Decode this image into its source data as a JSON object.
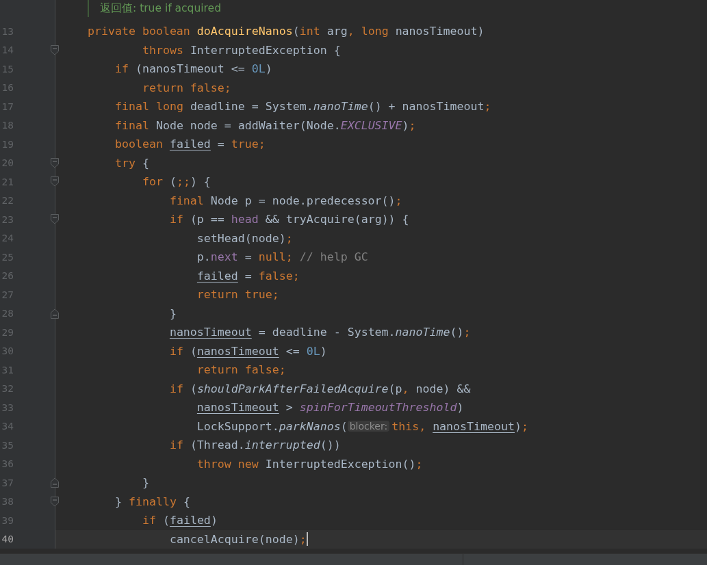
{
  "editor": {
    "doc_comment": "返回值: true if acquired",
    "lines": [
      {
        "number": "13",
        "fold_start": false,
        "fold_end": false,
        "current": false,
        "tokens": [
          {
            "kind": "keyword",
            "text": "private boolean "
          },
          {
            "kind": "method",
            "text": "doAcquireNanos"
          },
          {
            "kind": "plain",
            "text": "("
          },
          {
            "kind": "keyword",
            "text": "int "
          },
          {
            "kind": "plain",
            "text": "arg"
          },
          {
            "kind": "keyword",
            "text": ", long "
          },
          {
            "kind": "plain",
            "text": "nanosTimeout)"
          }
        ]
      },
      {
        "number": "14",
        "fold_start": true,
        "fold_end": false,
        "current": false,
        "tokens": [
          {
            "kind": "keyword",
            "text": "        throws "
          },
          {
            "kind": "plain",
            "text": "InterruptedException {"
          }
        ]
      },
      {
        "number": "15",
        "fold_start": false,
        "fold_end": false,
        "current": false,
        "tokens": [
          {
            "kind": "keyword",
            "text": "    if "
          },
          {
            "kind": "plain",
            "text": "(nanosTimeout <= "
          },
          {
            "kind": "number",
            "text": "0L"
          },
          {
            "kind": "plain",
            "text": ")"
          }
        ]
      },
      {
        "number": "16",
        "fold_start": false,
        "fold_end": false,
        "current": false,
        "tokens": [
          {
            "kind": "keyword",
            "text": "        return false;"
          }
        ]
      },
      {
        "number": "17",
        "fold_start": false,
        "fold_end": false,
        "current": false,
        "tokens": [
          {
            "kind": "keyword",
            "text": "    final long "
          },
          {
            "kind": "plain",
            "text": "deadline = System."
          },
          {
            "kind": "static",
            "text": "nanoTime"
          },
          {
            "kind": "plain",
            "text": "() + nanosTimeout"
          },
          {
            "kind": "keyword",
            "text": ";"
          }
        ]
      },
      {
        "number": "18",
        "fold_start": false,
        "fold_end": false,
        "current": false,
        "tokens": [
          {
            "kind": "keyword",
            "text": "    final "
          },
          {
            "kind": "plain",
            "text": "Node node = addWaiter(Node."
          },
          {
            "kind": "constant",
            "text": "EXCLUSIVE"
          },
          {
            "kind": "plain",
            "text": ")"
          },
          {
            "kind": "keyword",
            "text": ";"
          }
        ]
      },
      {
        "number": "19",
        "fold_start": false,
        "fold_end": false,
        "current": false,
        "tokens": [
          {
            "kind": "keyword",
            "text": "    boolean "
          },
          {
            "kind": "variable",
            "text": "failed"
          },
          {
            "kind": "plain",
            "text": " = "
          },
          {
            "kind": "keyword",
            "text": "true;"
          }
        ]
      },
      {
        "number": "20",
        "fold_start": true,
        "fold_end": false,
        "current": false,
        "tokens": [
          {
            "kind": "keyword",
            "text": "    try "
          },
          {
            "kind": "plain",
            "text": "{"
          }
        ]
      },
      {
        "number": "21",
        "fold_start": true,
        "fold_end": false,
        "current": false,
        "tokens": [
          {
            "kind": "keyword",
            "text": "        for "
          },
          {
            "kind": "plain",
            "text": "("
          },
          {
            "kind": "keyword",
            "text": ";;"
          },
          {
            "kind": "plain",
            "text": ") {"
          }
        ]
      },
      {
        "number": "22",
        "fold_start": false,
        "fold_end": false,
        "current": false,
        "tokens": [
          {
            "kind": "keyword",
            "text": "            final "
          },
          {
            "kind": "plain",
            "text": "Node p = node.predecessor()"
          },
          {
            "kind": "keyword",
            "text": ";"
          }
        ]
      },
      {
        "number": "23",
        "fold_start": true,
        "fold_end": false,
        "current": false,
        "tokens": [
          {
            "kind": "keyword",
            "text": "            if "
          },
          {
            "kind": "plain",
            "text": "(p == "
          },
          {
            "kind": "field",
            "text": "head"
          },
          {
            "kind": "plain",
            "text": " && tryAcquire(arg)) {"
          }
        ]
      },
      {
        "number": "24",
        "fold_start": false,
        "fold_end": false,
        "current": false,
        "tokens": [
          {
            "kind": "plain",
            "text": "                setHead(node)"
          },
          {
            "kind": "keyword",
            "text": ";"
          }
        ]
      },
      {
        "number": "25",
        "fold_start": false,
        "fold_end": false,
        "current": false,
        "tokens": [
          {
            "kind": "plain",
            "text": "                p."
          },
          {
            "kind": "field",
            "text": "next"
          },
          {
            "kind": "plain",
            "text": " = "
          },
          {
            "kind": "keyword",
            "text": "null;"
          },
          {
            "kind": "comment",
            "text": "// help GC"
          }
        ]
      },
      {
        "number": "26",
        "fold_start": false,
        "fold_end": false,
        "current": false,
        "tokens": [
          {
            "kind": "variable",
            "text": "                failed"
          },
          {
            "kind": "plain",
            "text": " = "
          },
          {
            "kind": "keyword",
            "text": "false;"
          }
        ]
      },
      {
        "number": "27",
        "fold_start": false,
        "fold_end": false,
        "current": false,
        "tokens": [
          {
            "kind": "keyword",
            "text": "                return true;"
          }
        ]
      },
      {
        "number": "28",
        "fold_start": false,
        "fold_end": true,
        "current": false,
        "tokens": [
          {
            "kind": "plain",
            "text": "            }"
          }
        ]
      },
      {
        "number": "29",
        "fold_start": false,
        "fold_end": false,
        "current": false,
        "tokens": [
          {
            "kind": "variable",
            "text": "            nanosTimeout"
          },
          {
            "kind": "plain",
            "text": " = deadline - System."
          },
          {
            "kind": "static",
            "text": "nanoTime"
          },
          {
            "kind": "plain",
            "text": "()"
          },
          {
            "kind": "keyword",
            "text": ";"
          }
        ]
      },
      {
        "number": "30",
        "fold_start": false,
        "fold_end": false,
        "current": false,
        "tokens": [
          {
            "kind": "keyword",
            "text": "            if "
          },
          {
            "kind": "plain",
            "text": "("
          },
          {
            "kind": "variable",
            "text": "nanosTimeout"
          },
          {
            "kind": "plain",
            "text": " <= "
          },
          {
            "kind": "number",
            "text": "0L"
          },
          {
            "kind": "plain",
            "text": ")"
          }
        ]
      },
      {
        "number": "31",
        "fold_start": false,
        "fold_end": false,
        "current": false,
        "tokens": [
          {
            "kind": "keyword",
            "text": "                return false;"
          }
        ]
      },
      {
        "number": "32",
        "fold_start": false,
        "fold_end": false,
        "current": false,
        "tokens": [
          {
            "kind": "keyword",
            "text": "            if "
          },
          {
            "kind": "plain",
            "text": "("
          },
          {
            "kind": "static",
            "text": "shouldParkAfterFailedAcquire"
          },
          {
            "kind": "plain",
            "text": "(p"
          },
          {
            "kind": "keyword",
            "text": ", "
          },
          {
            "kind": "plain",
            "text": "node) &&"
          }
        ]
      },
      {
        "number": "33",
        "fold_start": false,
        "fold_end": false,
        "current": false,
        "tokens": [
          {
            "kind": "variable",
            "text": "                nanosTimeout"
          },
          {
            "kind": "plain",
            "text": " > "
          },
          {
            "kind": "constant",
            "text": "spinForTimeoutThreshold"
          },
          {
            "kind": "plain",
            "text": ")"
          }
        ]
      },
      {
        "number": "34",
        "fold_start": false,
        "fold_end": false,
        "current": false,
        "tokens": [
          {
            "kind": "plain",
            "text": "                LockSupport."
          },
          {
            "kind": "static",
            "text": "parkNanos"
          },
          {
            "kind": "plain",
            "text": "("
          },
          {
            "kind": "hint",
            "text": "blocker:"
          },
          {
            "kind": "keyword",
            "text": "this, "
          },
          {
            "kind": "variable",
            "text": "nanosTimeout"
          },
          {
            "kind": "plain",
            "text": ")"
          },
          {
            "kind": "keyword",
            "text": ";"
          }
        ]
      },
      {
        "number": "35",
        "fold_start": false,
        "fold_end": false,
        "current": false,
        "tokens": [
          {
            "kind": "keyword",
            "text": "            if "
          },
          {
            "kind": "plain",
            "text": "(Thread."
          },
          {
            "kind": "static",
            "text": "interrupted"
          },
          {
            "kind": "plain",
            "text": "())"
          }
        ]
      },
      {
        "number": "36",
        "fold_start": false,
        "fold_end": false,
        "current": false,
        "tokens": [
          {
            "kind": "keyword",
            "text": "                throw new "
          },
          {
            "kind": "plain",
            "text": "InterruptedException()"
          },
          {
            "kind": "keyword",
            "text": ";"
          }
        ]
      },
      {
        "number": "37",
        "fold_start": false,
        "fold_end": true,
        "current": false,
        "tokens": [
          {
            "kind": "plain",
            "text": "        }"
          }
        ]
      },
      {
        "number": "38",
        "fold_start": true,
        "fold_end": false,
        "current": false,
        "tokens": [
          {
            "kind": "plain",
            "text": "    } "
          },
          {
            "kind": "keyword",
            "text": "finally "
          },
          {
            "kind": "plain",
            "text": "{"
          }
        ]
      },
      {
        "number": "39",
        "fold_start": false,
        "fold_end": false,
        "current": false,
        "tokens": [
          {
            "kind": "keyword",
            "text": "        if "
          },
          {
            "kind": "plain",
            "text": "("
          },
          {
            "kind": "variable",
            "text": "failed"
          },
          {
            "kind": "plain",
            "text": ")"
          }
        ]
      },
      {
        "number": "40",
        "fold_start": false,
        "fold_end": false,
        "current": true,
        "tokens": [
          {
            "kind": "plain",
            "text": "            cancelAcquire(node)"
          },
          {
            "kind": "keyword",
            "text": ";"
          }
        ]
      }
    ]
  }
}
